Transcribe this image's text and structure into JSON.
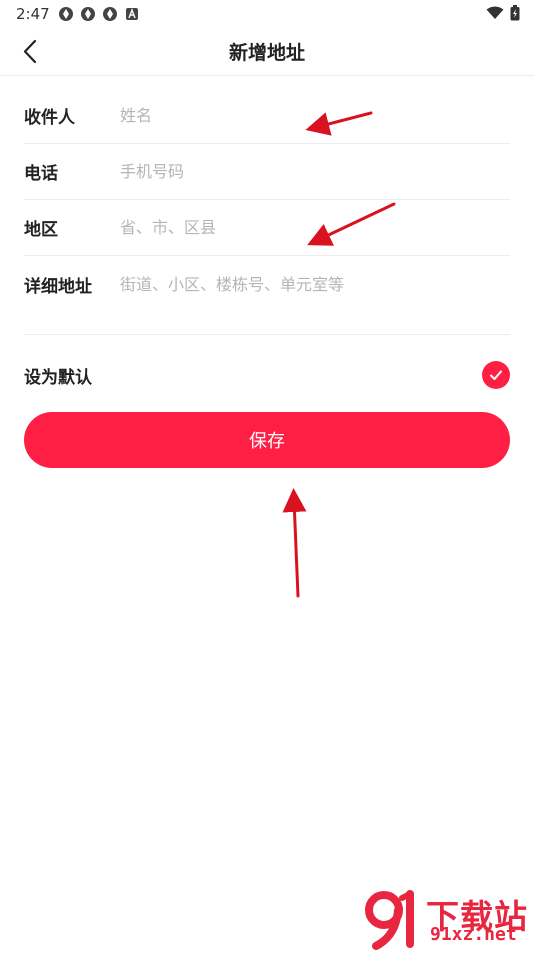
{
  "status_bar": {
    "time": "2:47",
    "left_icons": [
      "sync-icon",
      "sync-icon",
      "sync-icon",
      "a-badge-icon"
    ],
    "right_icons": [
      "wifi-icon",
      "battery-icon"
    ]
  },
  "header": {
    "title": "新增地址",
    "back_icon": "chevron-left-icon"
  },
  "form": {
    "fields": [
      {
        "label": "收件人",
        "placeholder": "姓名",
        "value": ""
      },
      {
        "label": "电话",
        "placeholder": "手机号码",
        "value": ""
      },
      {
        "label": "地区",
        "placeholder": "省、市、区县",
        "value": ""
      },
      {
        "label": "详细地址",
        "placeholder": "街道、小区、楼栋号、单元室等",
        "value": ""
      }
    ]
  },
  "default_toggle": {
    "label": "设为默认",
    "checked": true
  },
  "save_button": {
    "label": "保存"
  },
  "watermark": {
    "brand": "下载站",
    "url": "91xz.net"
  },
  "colors": {
    "accent": "#ff1f45",
    "annotation_arrow": "#d9121f"
  }
}
